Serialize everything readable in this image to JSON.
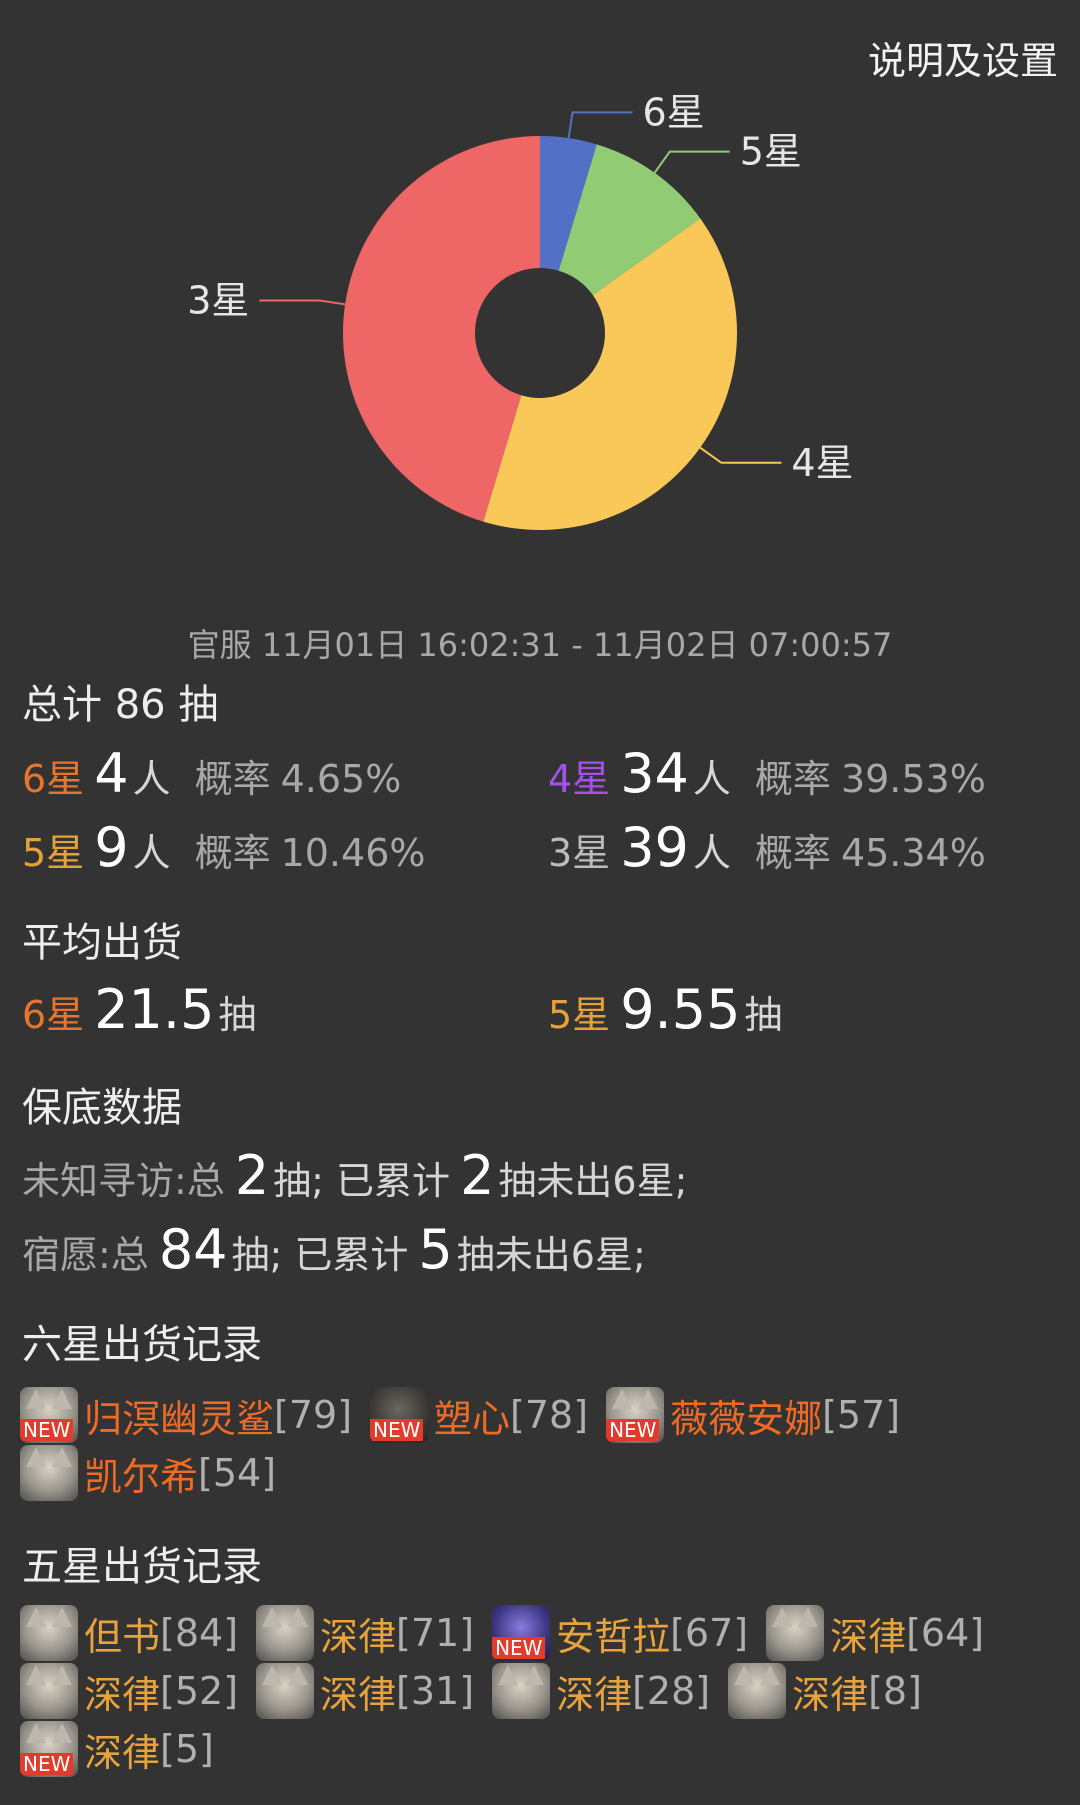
{
  "header": {
    "settings_label": "说明及设置"
  },
  "chart_data": {
    "type": "pie",
    "donut": true,
    "categories": [
      "6星",
      "5星",
      "4星",
      "3星"
    ],
    "values": [
      4,
      9,
      34,
      39
    ],
    "colors": [
      "#5470c6",
      "#91cc75",
      "#fac858",
      "#ee6666"
    ]
  },
  "date_range": "官服  11月01日 16:02:31  -  11月02日 07:00:57",
  "totals": {
    "title": "总计 86 抽",
    "unit": "人",
    "rate_label": "概率",
    "items": [
      {
        "star": "6星",
        "count": "4",
        "rate": "4.65%",
        "color": "#e8752c"
      },
      {
        "star": "4星",
        "count": "34",
        "rate": "39.53%",
        "color": "#a451ec"
      },
      {
        "star": "5星",
        "count": "9",
        "rate": "10.46%",
        "color": "#e5a236"
      },
      {
        "star": "3星",
        "count": "39",
        "rate": "45.34%",
        "color": "#bcbcbc"
      }
    ]
  },
  "average": {
    "title": "平均出货",
    "unit": "抽",
    "items": [
      {
        "star": "6星",
        "value": "21.5"
      },
      {
        "star": "5星",
        "value": "9.55"
      }
    ]
  },
  "pity": {
    "title": "保底数据",
    "rows": [
      {
        "prefix": "未知寻访:总",
        "total": "2",
        "mid": "抽; 已累计",
        "acc": "2",
        "suffix": "抽未出6星;"
      },
      {
        "prefix": "宿愿:总",
        "total": "84",
        "mid": "抽; 已累计",
        "acc": "5",
        "suffix": "抽未出6星;"
      }
    ]
  },
  "six_star_records": {
    "title": "六星出货记录",
    "badge_text": "NEW",
    "items": [
      {
        "name": "归溟幽灵鲨",
        "pull": "[79]",
        "is_new": true
      },
      {
        "name": "塑心",
        "pull": "[78]",
        "is_new": true
      },
      {
        "name": "薇薇安娜",
        "pull": "[57]",
        "is_new": true
      },
      {
        "name": "凯尔希",
        "pull": "[54]",
        "is_new": false
      }
    ]
  },
  "five_star_records": {
    "title": "五星出货记录",
    "badge_text": "NEW",
    "items": [
      {
        "name": "但书",
        "pull": "[84]",
        "is_new": false
      },
      {
        "name": "深律",
        "pull": "[71]",
        "is_new": false
      },
      {
        "name": "安哲拉",
        "pull": "[67]",
        "is_new": true
      },
      {
        "name": "深律",
        "pull": "[64]",
        "is_new": false
      },
      {
        "name": "深律",
        "pull": "[52]",
        "is_new": false
      },
      {
        "name": "深律",
        "pull": "[31]",
        "is_new": false
      },
      {
        "name": "深律",
        "pull": "[28]",
        "is_new": false
      },
      {
        "name": "深律",
        "pull": "[8]",
        "is_new": false
      },
      {
        "name": "深律",
        "pull": "[5]",
        "is_new": true
      }
    ]
  }
}
